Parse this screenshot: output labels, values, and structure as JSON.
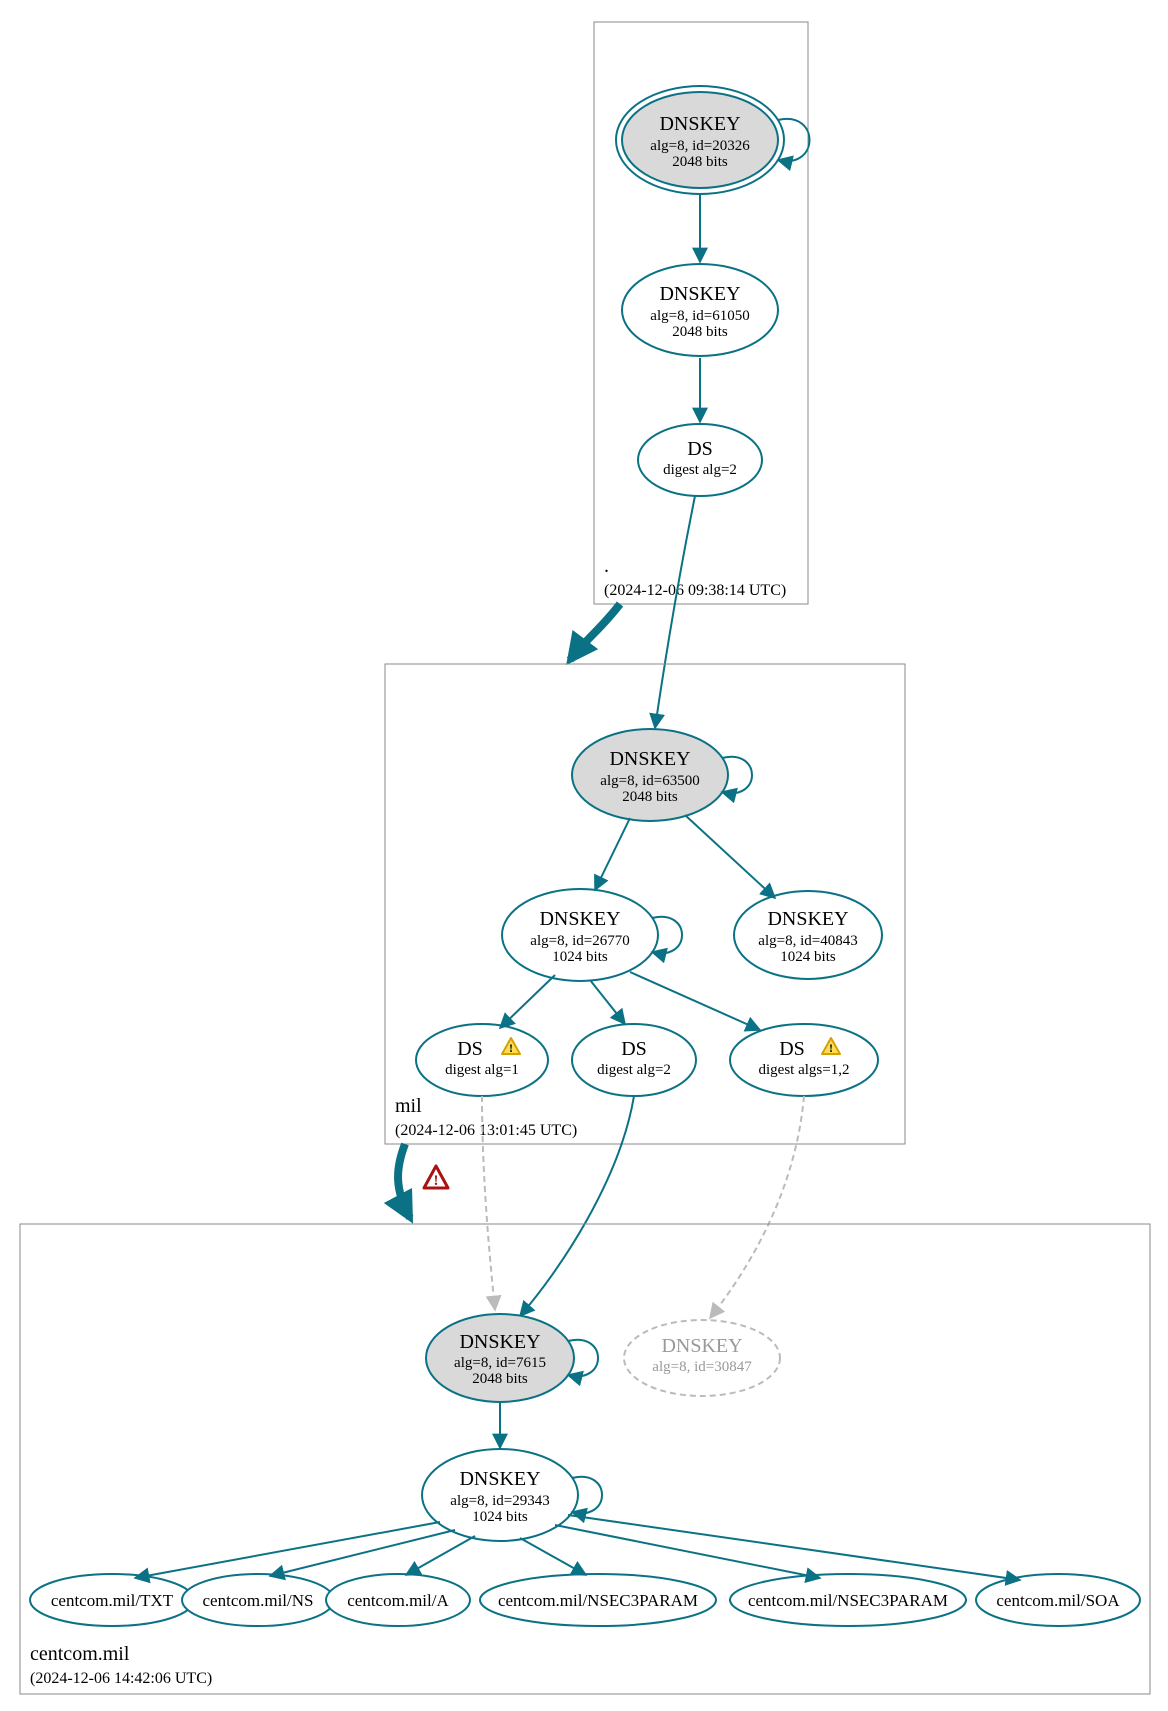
{
  "zones": {
    "root": {
      "label": ".",
      "timestamp": "(2024-12-06 09:38:14 UTC)"
    },
    "mil": {
      "label": "mil",
      "timestamp": "(2024-12-06 13:01:45 UTC)"
    },
    "centcom": {
      "label": "centcom.mil",
      "timestamp": "(2024-12-06 14:42:06 UTC)"
    }
  },
  "nodes": {
    "root_ksk": {
      "title": "DNSKEY",
      "sub1": "alg=8, id=20326",
      "sub2": "2048 bits"
    },
    "root_zsk": {
      "title": "DNSKEY",
      "sub1": "alg=8, id=61050",
      "sub2": "2048 bits"
    },
    "root_ds": {
      "title": "DS",
      "sub1": "digest alg=2"
    },
    "mil_ksk": {
      "title": "DNSKEY",
      "sub1": "alg=8, id=63500",
      "sub2": "2048 bits"
    },
    "mil_zsk": {
      "title": "DNSKEY",
      "sub1": "alg=8, id=26770",
      "sub2": "1024 bits"
    },
    "mil_key2": {
      "title": "DNSKEY",
      "sub1": "alg=8, id=40843",
      "sub2": "1024 bits"
    },
    "mil_ds1": {
      "title": "DS",
      "sub1": "digest alg=1"
    },
    "mil_ds2": {
      "title": "DS",
      "sub1": "digest alg=2"
    },
    "mil_ds3": {
      "title": "DS",
      "sub1": "digest algs=1,2"
    },
    "cc_ksk": {
      "title": "DNSKEY",
      "sub1": "alg=8, id=7615",
      "sub2": "2048 bits"
    },
    "cc_key2": {
      "title": "DNSKEY",
      "sub1": "alg=8, id=30847"
    },
    "cc_zsk": {
      "title": "DNSKEY",
      "sub1": "alg=8, id=29343",
      "sub2": "1024 bits"
    },
    "rr_txt": {
      "title": "centcom.mil/TXT"
    },
    "rr_ns": {
      "title": "centcom.mil/NS"
    },
    "rr_a": {
      "title": "centcom.mil/A"
    },
    "rr_n3p1": {
      "title": "centcom.mil/NSEC3PARAM"
    },
    "rr_n3p2": {
      "title": "centcom.mil/NSEC3PARAM"
    },
    "rr_soa": {
      "title": "centcom.mil/SOA"
    }
  },
  "chart_data": {
    "type": "dnssec-delegation-graph",
    "zones": [
      {
        "name": ".",
        "analyzed": "2024-12-06 09:38:14 UTC",
        "keys": [
          {
            "role": "KSK",
            "alg": 8,
            "id": 20326,
            "bits": 2048,
            "trust_anchor": true
          },
          {
            "role": "ZSK",
            "alg": 8,
            "id": 61050,
            "bits": 2048
          }
        ],
        "ds_for_child": [
          {
            "digest_alg": 2,
            "child": "mil"
          }
        ]
      },
      {
        "name": "mil",
        "analyzed": "2024-12-06 13:01:45 UTC",
        "keys": [
          {
            "role": "KSK",
            "alg": 8,
            "id": 63500,
            "bits": 2048
          },
          {
            "role": "ZSK",
            "alg": 8,
            "id": 26770,
            "bits": 1024
          },
          {
            "role": "ZSK",
            "alg": 8,
            "id": 40843,
            "bits": 1024
          }
        ],
        "ds_for_child": [
          {
            "digest_alg": 1,
            "child": "centcom.mil",
            "status": "warning"
          },
          {
            "digest_alg": 2,
            "child": "centcom.mil",
            "status": "secure"
          },
          {
            "digest_algs": [
              1,
              2
            ],
            "child": "centcom.mil",
            "status": "warning",
            "matches_key": false
          }
        ],
        "delegation_status_from_parent": "secure"
      },
      {
        "name": "centcom.mil",
        "analyzed": "2024-12-06 14:42:06 UTC",
        "keys": [
          {
            "role": "KSK",
            "alg": 8,
            "id": 7615,
            "bits": 2048
          },
          {
            "role": "unknown",
            "alg": 8,
            "id": 30847,
            "present": false
          },
          {
            "role": "ZSK",
            "alg": 8,
            "id": 29343,
            "bits": 1024
          }
        ],
        "rrsets_signed": [
          "TXT",
          "NS",
          "A",
          "NSEC3PARAM",
          "NSEC3PARAM",
          "SOA"
        ],
        "delegation_status_from_parent": "warning"
      }
    ]
  }
}
